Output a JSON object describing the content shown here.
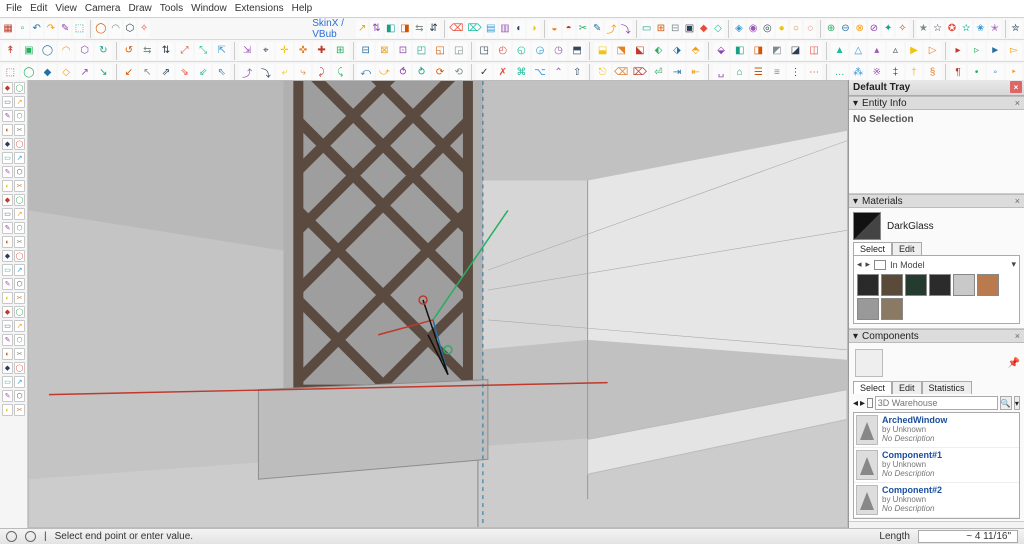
{
  "menu": {
    "items": [
      "File",
      "Edit",
      "View",
      "Camera",
      "Draw",
      "Tools",
      "Window",
      "Extensions",
      "Help"
    ]
  },
  "toolrow1_label": "SkinX / VBub",
  "scene_tab": "316d126a33644ace9127628142d997ff",
  "tray": {
    "title": "Default Tray",
    "entity": {
      "title": "Entity Info",
      "no_selection": "No Selection"
    },
    "materials": {
      "title": "Materials",
      "current_name": "DarkGlass",
      "tabs": [
        "Select",
        "Edit"
      ],
      "active_tab": 0,
      "library": "In Model",
      "swatches": [
        "#2a2a2a",
        "#5a4a3a",
        "#263b2f",
        "#2b2b2b",
        "#c9c9c9",
        "#b97a4e",
        "#999999",
        "#8a7a63"
      ]
    },
    "components": {
      "title": "Components",
      "tabs": [
        "Select",
        "Edit",
        "Statistics"
      ],
      "active_tab": 0,
      "search_placeholder": "3D Warehouse",
      "items": [
        {
          "name": "ArchedWindow",
          "author": "Unknown",
          "desc": "No Description"
        },
        {
          "name": "Component#1",
          "author": "Unknown",
          "desc": "No Description"
        },
        {
          "name": "Component#2",
          "author": "Unknown",
          "desc": "No Description"
        }
      ]
    }
  },
  "status": {
    "hint": "Select end point or enter value.",
    "measure_label": "Length",
    "measure_value": "~ 4 11/16\""
  },
  "tool_glyphs_row1": [
    "▦",
    "▫",
    "↶",
    "↷",
    "✎",
    "⬚",
    "◯",
    "◠",
    "⬡",
    "✧",
    "↗",
    "⇅",
    "◧",
    "◨",
    "⇆",
    "⇵",
    "⌫",
    "⌦",
    "▤",
    "▥",
    "◐",
    "◑",
    "◒",
    "◓",
    "✂",
    "✎",
    "⤴",
    "⤵",
    "▭",
    "⊞",
    "⊟",
    "▣",
    "◆",
    "◇",
    "◈",
    "◉",
    "◎",
    "●",
    "○",
    "◌",
    "⊕",
    "⊖",
    "⊗",
    "⊘",
    "✦",
    "✧",
    "★",
    "☆",
    "✪",
    "✫",
    "✬",
    "✭",
    "✮"
  ],
  "tool_glyphs_row2": [
    "↟",
    "▣",
    "◯",
    "◠",
    "⬡",
    "↻",
    "↺",
    "⇆",
    "⇅",
    "⤢",
    "⤡",
    "⇱",
    "⇲",
    "⌖",
    "✛",
    "✜",
    "✚",
    "⊞",
    "⊟",
    "⊠",
    "⊡",
    "◰",
    "◱",
    "◲",
    "◳",
    "◴",
    "◵",
    "◶",
    "◷",
    "⬒",
    "⬓",
    "⬔",
    "⬕",
    "⬖",
    "⬗",
    "⬘",
    "⬙",
    "◧",
    "◨",
    "◩",
    "◪",
    "◫",
    "▲",
    "△",
    "▴",
    "▵",
    "▶",
    "▷",
    "▸",
    "▹",
    "►",
    "▻"
  ],
  "tool_glyphs_row3": [
    "⬚",
    "◯",
    "◆",
    "◇",
    "↗",
    "↘",
    "↙",
    "↖",
    "⇗",
    "⇘",
    "⇙",
    "⇖",
    "⤴",
    "⤵",
    "⤶",
    "⤷",
    "⤸",
    "⤹",
    "⤺",
    "⤻",
    "⥀",
    "⥁",
    "⟳",
    "⟲",
    "✓",
    "✗",
    "⌘",
    "⌥",
    "⌃",
    "⇧",
    "⎋",
    "⌫",
    "⌦",
    "⏎",
    "⇥",
    "⇤",
    "␣",
    "⌂",
    "☰",
    "≡",
    "⋮",
    "⋯",
    "…",
    "⁂",
    "※",
    "‡",
    "†",
    "§",
    "¶",
    "•",
    "◦",
    "‣"
  ],
  "axes": {
    "r": "#c0392b",
    "g": "#27ae60",
    "b": "#2471a3"
  },
  "tool_colors": [
    "#c0392b",
    "#27ae60",
    "#2471a3",
    "#f39c12",
    "#8e44ad",
    "#16a085",
    "#d35400",
    "#7f8c8d",
    "#2c3e50",
    "#e74c3c",
    "#1abc9c",
    "#3498db",
    "#9b59b6",
    "#34495e",
    "#f1c40f",
    "#e67e22"
  ]
}
